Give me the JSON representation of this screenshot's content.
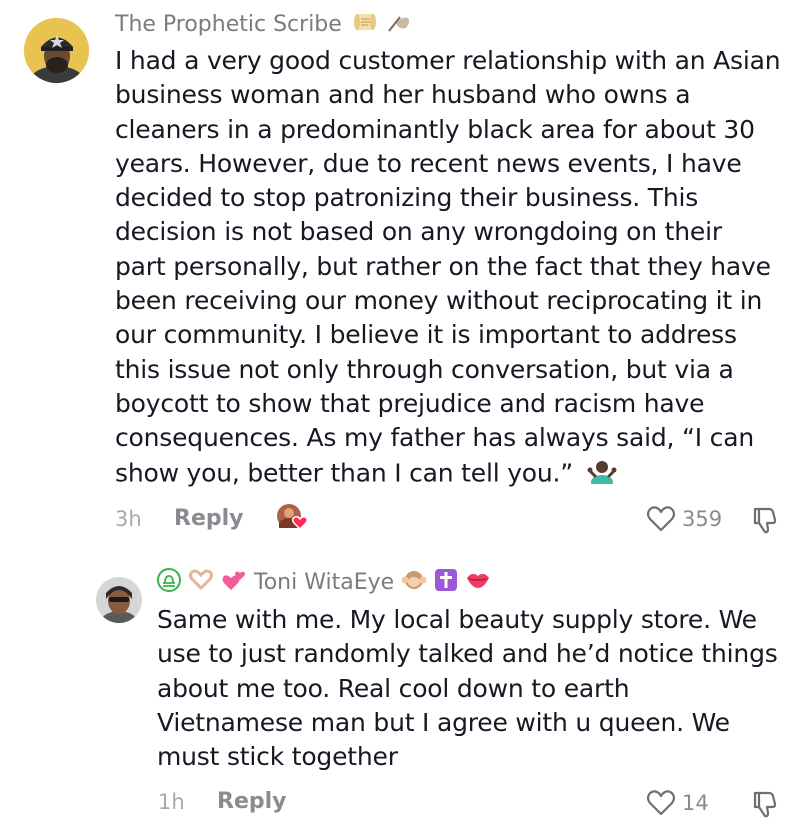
{
  "comments": [
    {
      "author": "The Prophetic Scribe",
      "text_lines": [
        "I had a very good customer relationship with an Asian",
        "business woman and her husband who owns a",
        "cleaners in a predominantly black area for about 30",
        "years. However, due to recent news events, I have",
        "decided to stop patronizing their business. This",
        "decision is not based on any wrongdoing on their",
        "part personally, but rather on the fact that they have",
        "been receiving our money without reciprocating it in",
        "our community. I believe it is important to address",
        "this issue not only through conversation, but via a",
        "boycott to show that prejudice and racism have",
        "consequences. As my father has always said, “I can",
        "show you, better than I can tell you.”"
      ],
      "time": "3h",
      "reply_label": "Reply",
      "likes": "359",
      "icons": [
        "scroll-emoji",
        "writing-hand-emoji",
        "shrug-emoji",
        "creator-liked-badge",
        "heart-icon",
        "dislike-icon"
      ]
    },
    {
      "author": "Toni WitaEye",
      "text_lines": [
        "Same with me. My local beauty supply store. We",
        "use to just randomly talked and he’d notice things",
        "about me too. Real cool down to earth",
        "Vietnamese man but I agree with u queen. We",
        "must stick together"
      ],
      "time": "1h",
      "reply_label": "Reply",
      "likes": "14",
      "icons": [
        "libra-emoji",
        "heart-hands-emoji",
        "two-hearts-emoji",
        "hear-no-evil-emoji",
        "cross-emoji",
        "lips-emoji",
        "heart-icon",
        "dislike-icon"
      ]
    }
  ],
  "colors": {
    "text": "#161823",
    "author": "#7b7b80",
    "meta": "#a8a8ad",
    "liked_heart": "#fe2c55"
  }
}
